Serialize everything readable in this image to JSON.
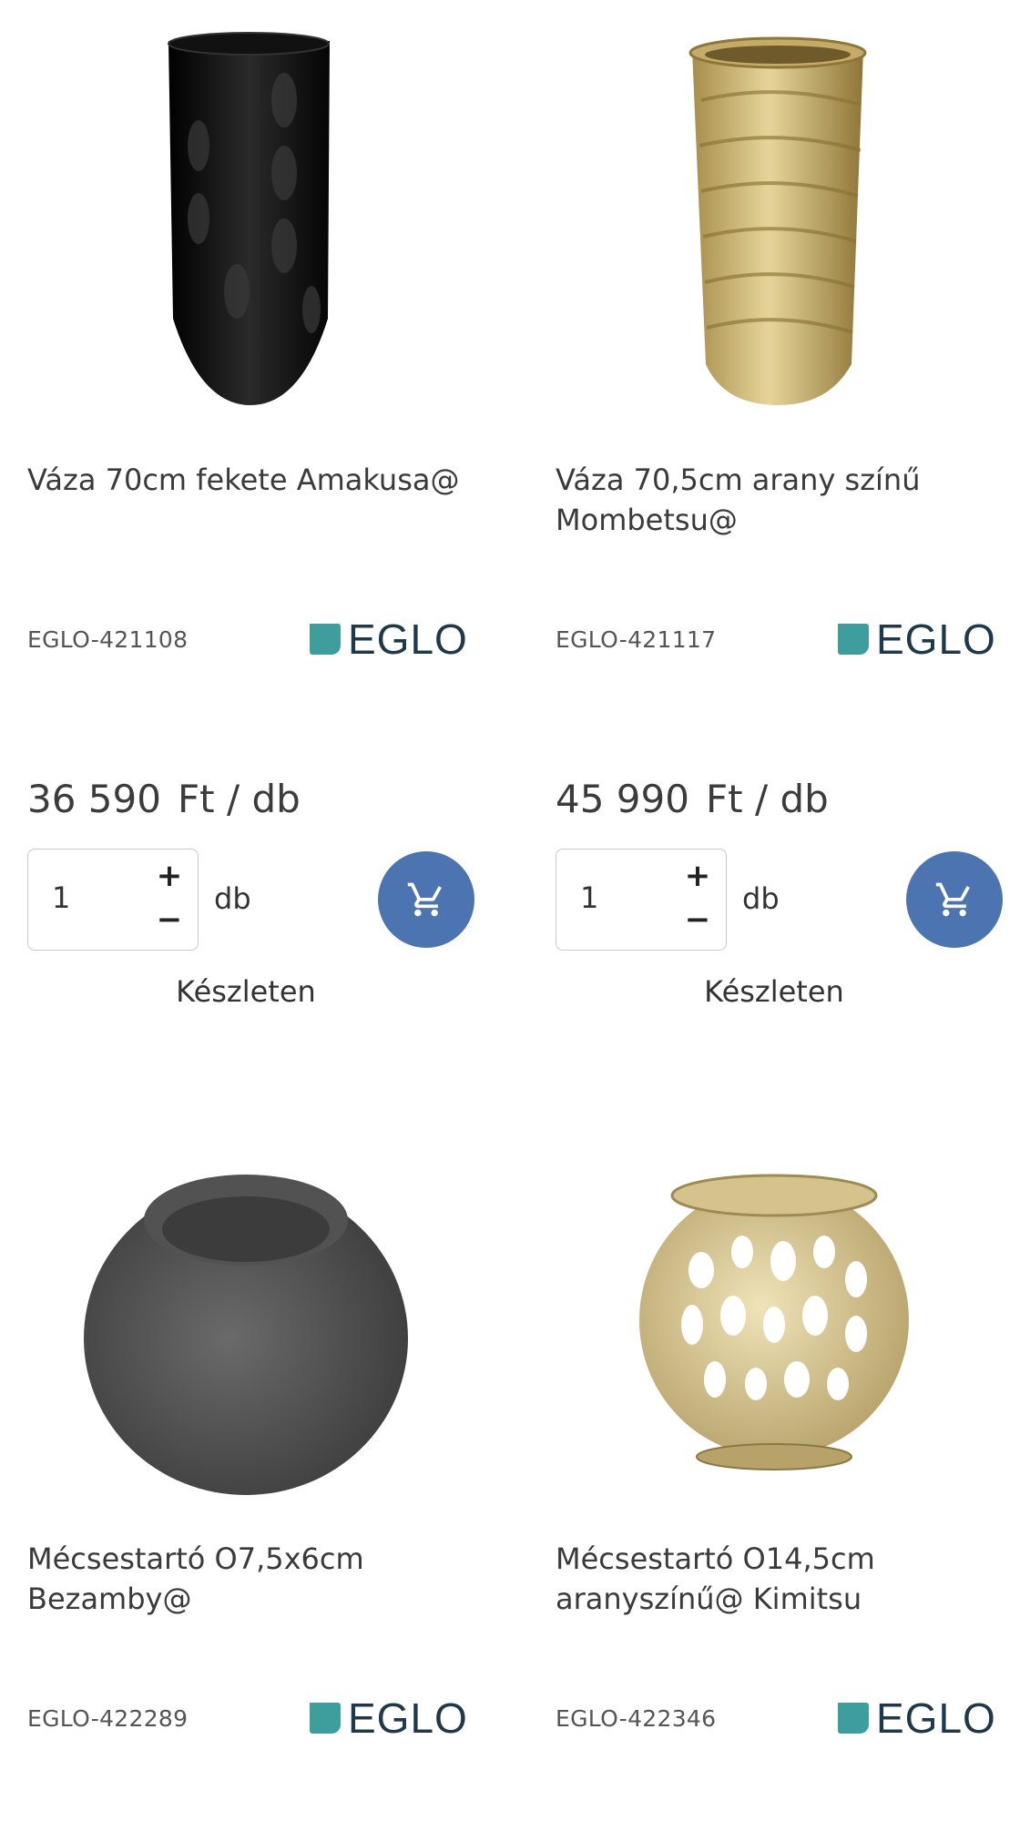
{
  "products": [
    {
      "image": "black-vase",
      "title": "Váza 70cm fekete Amakusa@",
      "sku": "EGLO-421108",
      "brand": "EGLO",
      "price": "36 590",
      "price_unit": "Ft / db",
      "quantity": "1",
      "quantity_unit": "db",
      "stock": "Készleten"
    },
    {
      "image": "gold-vase",
      "title": "Váza 70,5cm arany színű Mombetsu@",
      "sku": "EGLO-421117",
      "brand": "EGLO",
      "price": "45 990",
      "price_unit": "Ft / db",
      "quantity": "1",
      "quantity_unit": "db",
      "stock": "Készleten"
    },
    {
      "image": "grey-candle-holder",
      "title": "Mécsestartó O7,5x6cm Bezamby@",
      "sku": "EGLO-422289",
      "brand": "EGLO"
    },
    {
      "image": "gold-candle-holder",
      "title": "Mécsestartó O14,5cm aranyszínű@ Kimitsu",
      "sku": "EGLO-422346",
      "brand": "EGLO"
    }
  ],
  "colors": {
    "cart_button": "#4c74b0",
    "brand_mark": "#3e9e9e",
    "brand_text": "#20394a"
  },
  "icons": {
    "plus": "+",
    "minus": "−",
    "cart": "cart-icon"
  }
}
